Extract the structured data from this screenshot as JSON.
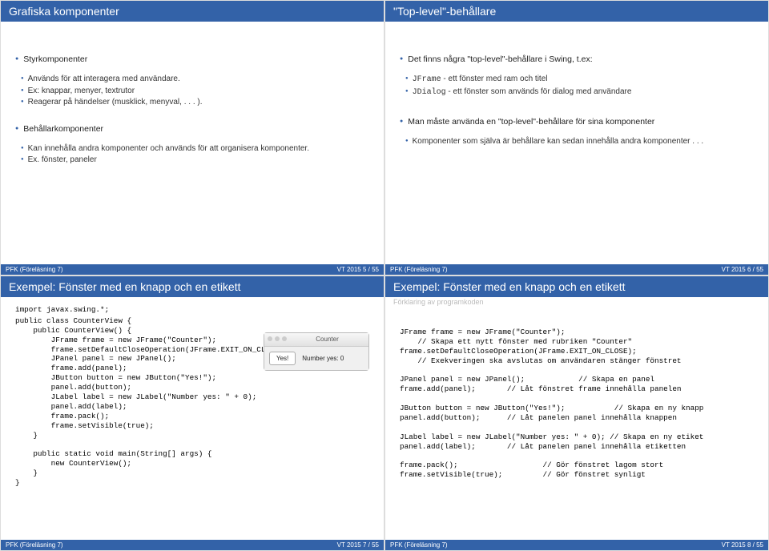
{
  "slides": [
    {
      "title": "Grafiska komponenter",
      "h1a": "Styrkomponenter",
      "h1a_items": [
        "Används för att interagera med användare.",
        "Ex: knappar, menyer, textrutor",
        "Reagerar på händelser (musklick, menyval, . . . )."
      ],
      "h1b": "Behållarkomponenter",
      "h1b_items": [
        "Kan innehålla andra komponenter och används för att organisera komponenter.",
        "Ex. fönster, paneler"
      ],
      "footer_left": "PFK (Föreläsning 7)",
      "footer_center": "",
      "footer_right": "VT 2015    5 / 55"
    },
    {
      "title": "\"Top-level\"-behållare",
      "h2a": "Det finns några \"top-level\"-behållare i Swing, t.ex:",
      "h2a_items": [
        "JFrame - ett fönster med ram och titel",
        "JDialog - ett fönster som används för dialog med användare"
      ],
      "h2b": "Man måste använda en \"top-level\"-behållare för sina komponenter",
      "h2b_items": [
        "Komponenter som själva är behållare kan sedan innehålla andra komponenter . . ."
      ],
      "footer_left": "PFK (Föreläsning 7)",
      "footer_center": "",
      "footer_right": "VT 2015    6 / 55"
    },
    {
      "title": "Exempel: Fönster med en knapp och en etikett",
      "import_line": "import javax.swing.*;",
      "mock_title": "Counter",
      "mock_btn": "Yes!",
      "mock_label": "Number yes: 0",
      "code": "public class CounterView {\n    public CounterView() {\n        JFrame frame = new JFrame(\"Counter\");\n        frame.setDefaultCloseOperation(JFrame.EXIT_ON_CLOSE);\n        JPanel panel = new JPanel();\n        frame.add(panel);\n        JButton button = new JButton(\"Yes!\");\n        panel.add(button);\n        JLabel label = new JLabel(\"Number yes: \" + 0);\n        panel.add(label);\n        frame.pack();\n        frame.setVisible(true);\n    }\n\n    public static void main(String[] args) {\n        new CounterView();\n    }\n}",
      "footer_left": "PFK (Föreläsning 7)",
      "footer_center": "",
      "footer_right": "VT 2015    7 / 55"
    },
    {
      "title": "Exempel: Fönster med en knapp och en etikett",
      "subtitle": "Förklaring av programkoden",
      "code": "JFrame frame = new JFrame(\"Counter\");\n    // Skapa ett nytt fönster med rubriken \"Counter\"\nframe.setDefaultCloseOperation(JFrame.EXIT_ON_CLOSE);\n    // Exekveringen ska avslutas om användaren stänger fönstret\n\nJPanel panel = new JPanel();            // Skapa en panel\nframe.add(panel);       // Låt fönstret frame innehålla panelen\n\nJButton button = new JButton(\"Yes!\");           // Skapa en ny knapp\npanel.add(button);      // Låt panelen panel innehålla knappen\n\nJLabel label = new JLabel(\"Number yes: \" + 0); // Skapa en ny etiket\npanel.add(label);       // Låt panelen panel innehålla etiketten\n\nframe.pack();                   // Gör fönstret lagom stort\nframe.setVisible(true);         // Gör fönstret synligt",
      "footer_left": "PFK (Föreläsning 7)",
      "footer_center": "",
      "footer_right": "VT 2015    8 / 55"
    }
  ]
}
